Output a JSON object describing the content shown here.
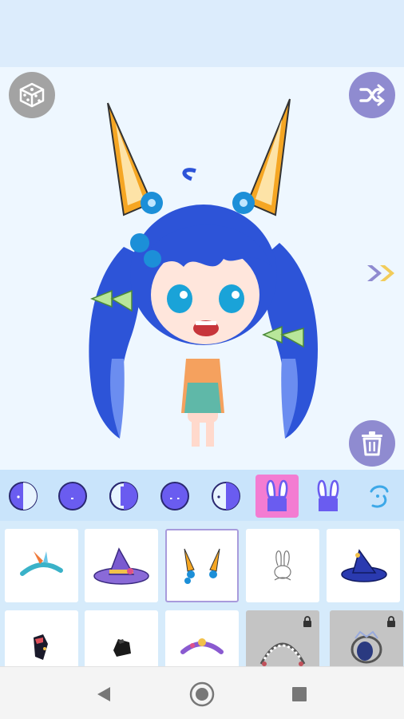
{
  "colors": {
    "banner": "#dcecfc",
    "stage_bg": "#eef7ff",
    "accent_purple": "#8f8bd0",
    "dice_gray": "#a3a3a3",
    "tab_bar": "#c9e4fb",
    "tab_active": "#f37cd2",
    "grid_bg": "#d6ebfb",
    "hair_blue": "#2d54d8",
    "ear_orange": "#f5a623"
  },
  "toolbar": {
    "random_icon": "dice-icon",
    "shuffle_icon": "shuffle-icon",
    "delete_icon": "trash-icon",
    "next_icon": "double-chevron-right-icon"
  },
  "category_tabs": [
    {
      "icon": "skin-tone-1-icon",
      "active": false
    },
    {
      "icon": "skin-tone-2-icon",
      "active": false
    },
    {
      "icon": "skin-tone-3-icon",
      "active": false
    },
    {
      "icon": "skin-tone-4-icon",
      "active": false
    },
    {
      "icon": "skin-tone-5-icon",
      "active": false
    },
    {
      "icon": "bunny-ears-icon",
      "active": true
    },
    {
      "icon": "ears-icon",
      "active": false
    },
    {
      "icon": "swirl-icon",
      "active": false
    }
  ],
  "items": [
    {
      "icon": "feather-headband-icon",
      "selected": false,
      "locked": false
    },
    {
      "icon": "witch-hat-purple-icon",
      "selected": false,
      "locked": false
    },
    {
      "icon": "fox-ears-icon",
      "selected": true,
      "locked": false
    },
    {
      "icon": "bunny-sketch-icon",
      "selected": false,
      "locked": false
    },
    {
      "icon": "witch-hat-blue-icon",
      "selected": false,
      "locked": false
    },
    {
      "icon": "star-bow-icon",
      "selected": false,
      "locked": false
    },
    {
      "icon": "small-hat-icon",
      "selected": false,
      "locked": false
    },
    {
      "icon": "purple-headband-icon",
      "selected": false,
      "locked": false
    },
    {
      "icon": "lace-headband-icon",
      "selected": false,
      "locked": true
    },
    {
      "icon": "crown-headpiece-icon",
      "selected": false,
      "locked": true
    }
  ],
  "navbar": {
    "back_icon": "back-triangle-icon",
    "home_icon": "home-circle-icon",
    "recents_icon": "recents-square-icon"
  }
}
